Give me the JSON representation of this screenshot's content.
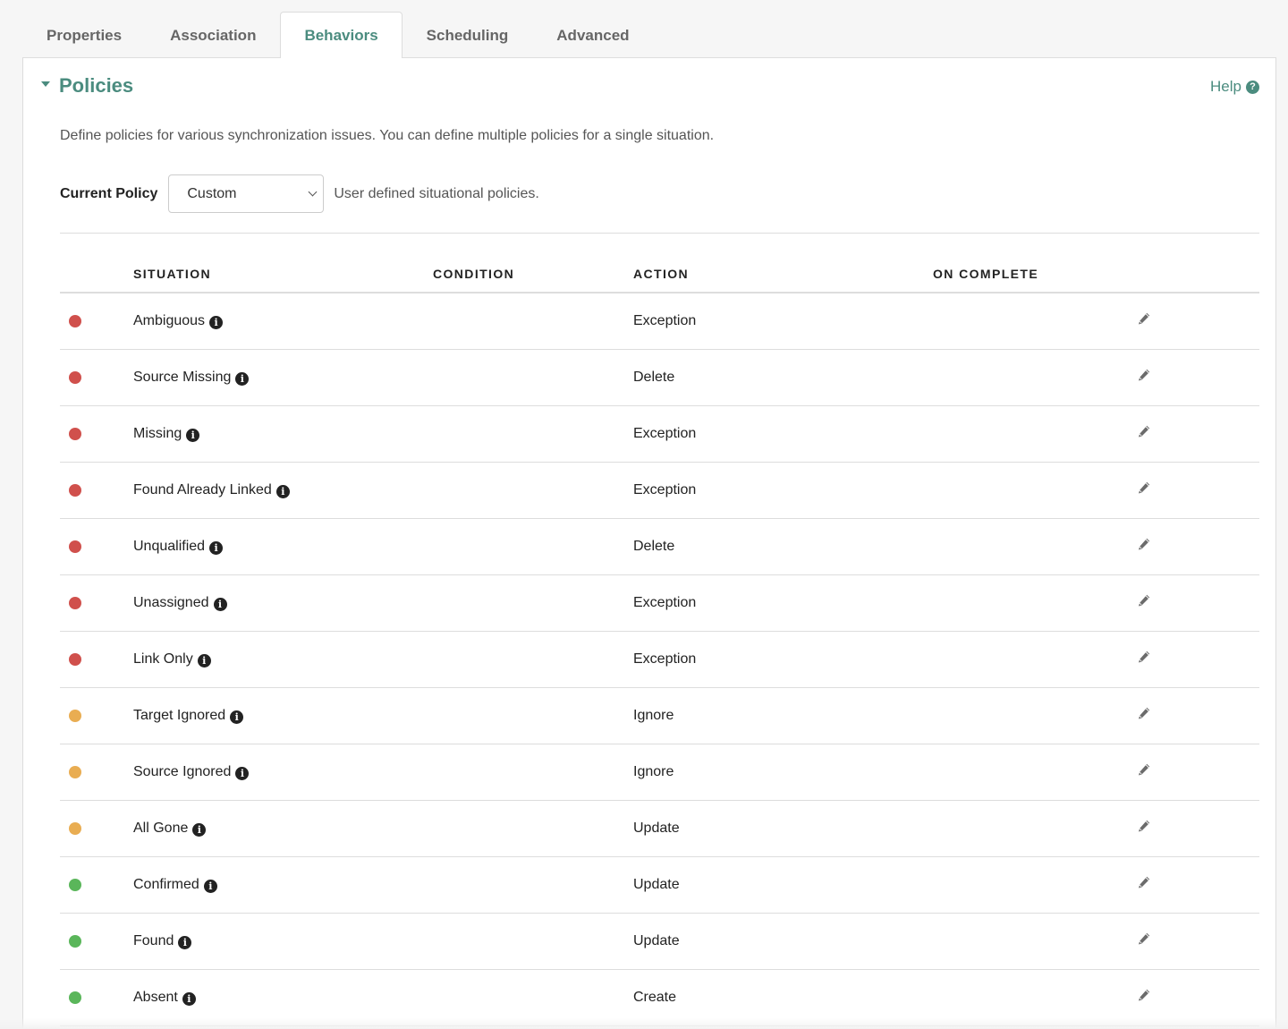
{
  "tabs": [
    {
      "label": "Properties",
      "active": false
    },
    {
      "label": "Association",
      "active": false
    },
    {
      "label": "Behaviors",
      "active": true
    },
    {
      "label": "Scheduling",
      "active": false
    },
    {
      "label": "Advanced",
      "active": false
    }
  ],
  "section": {
    "title": "Policies",
    "help_label": "Help",
    "help_icon": "question-circle-icon",
    "description": "Define policies for various synchronization issues. You can define multiple policies for a single situation."
  },
  "policy": {
    "label": "Current Policy",
    "selected": "Custom",
    "note": "User defined situational policies."
  },
  "table": {
    "headers": {
      "situation": "SITUATION",
      "condition": "CONDITION",
      "action": "ACTION",
      "on_complete": "ON COMPLETE"
    },
    "rows": [
      {
        "situation": "Ambiguous",
        "condition": "",
        "action": "Exception",
        "on_complete": "",
        "status": "red"
      },
      {
        "situation": "Source Missing",
        "condition": "",
        "action": "Delete",
        "on_complete": "",
        "status": "red"
      },
      {
        "situation": "Missing",
        "condition": "",
        "action": "Exception",
        "on_complete": "",
        "status": "red"
      },
      {
        "situation": "Found Already Linked",
        "condition": "",
        "action": "Exception",
        "on_complete": "",
        "status": "red"
      },
      {
        "situation": "Unqualified",
        "condition": "",
        "action": "Delete",
        "on_complete": "",
        "status": "red"
      },
      {
        "situation": "Unassigned",
        "condition": "",
        "action": "Exception",
        "on_complete": "",
        "status": "red"
      },
      {
        "situation": "Link Only",
        "condition": "",
        "action": "Exception",
        "on_complete": "",
        "status": "red"
      },
      {
        "situation": "Target Ignored",
        "condition": "",
        "action": "Ignore",
        "on_complete": "",
        "status": "yellow"
      },
      {
        "situation": "Source Ignored",
        "condition": "",
        "action": "Ignore",
        "on_complete": "",
        "status": "yellow"
      },
      {
        "situation": "All Gone",
        "condition": "",
        "action": "Update",
        "on_complete": "",
        "status": "yellow"
      },
      {
        "situation": "Confirmed",
        "condition": "",
        "action": "Update",
        "on_complete": "",
        "status": "green"
      },
      {
        "situation": "Found",
        "condition": "",
        "action": "Update",
        "on_complete": "",
        "status": "green"
      },
      {
        "situation": "Absent",
        "condition": "",
        "action": "Create",
        "on_complete": "",
        "status": "green"
      }
    ]
  },
  "colors": {
    "accent": "#4b8c7f",
    "red": "#d0504c",
    "yellow": "#e9ad52",
    "green": "#5ab65a"
  },
  "icons": {
    "info": "info-circle-icon",
    "edit": "pencil-icon"
  }
}
